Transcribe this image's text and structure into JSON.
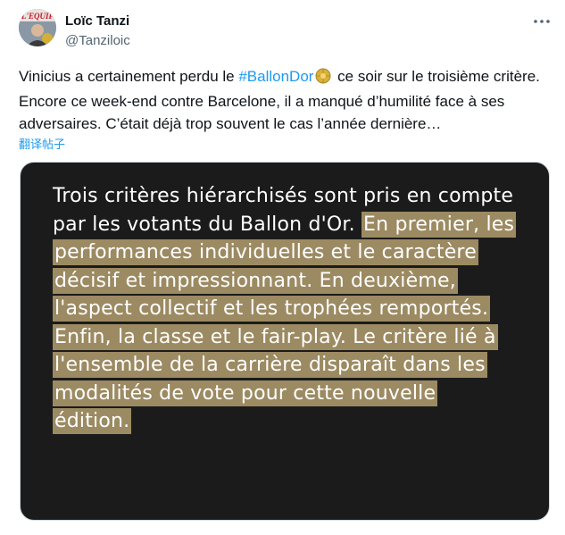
{
  "author": {
    "name": "Loïc Tanzi",
    "handle": "@Tanziloic",
    "avatar_badge": "L'EQUIP"
  },
  "tweet": {
    "text_before": "Vinicius a certainement perdu le ",
    "hashtag": "#BallonDor",
    "text_after": " ce soir sur le troisième critère. Encore ce week-end contre Barcelone, il a manqué d’humilité face à ses adversaires. C’était déjà trop souvent le cas l’année dernière…"
  },
  "translate_label": "翻译帖子",
  "image_quote": {
    "plain": "Trois critères hiérarchisés sont pris en compte par les votants du Ballon d'Or. ",
    "highlighted": "En premier, les performances individuelles et le caractère décisif et impressionnant. En deuxième, l'aspect collectif et les trophées remportés. Enfin, la classe et le fair-play. Le critère lié à l'ensemble de la carrière disparaît dans les modalités de vote pour cette nouvelle édition."
  },
  "icons": {
    "more": "more-options-icon",
    "hashtag_emoji": "ballon-dor-emoji-icon"
  },
  "colors": {
    "accent": "#1d9bf0",
    "highlight": "#9c8a62",
    "media_background": "#1b1b1b"
  }
}
